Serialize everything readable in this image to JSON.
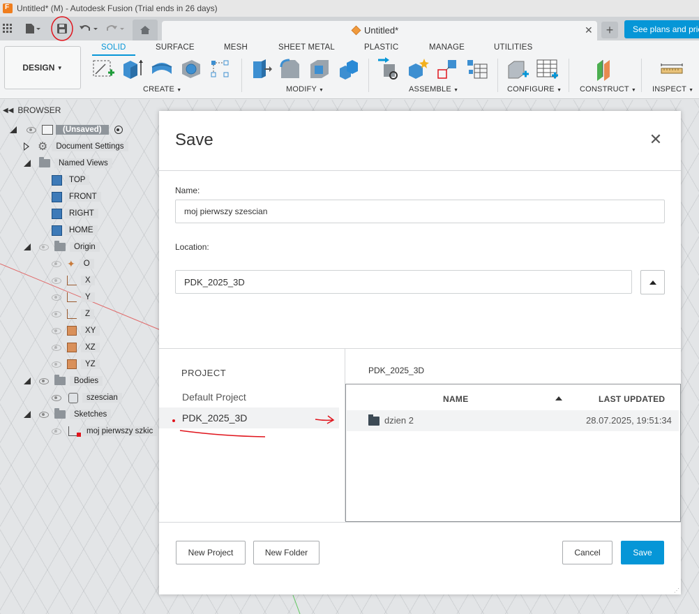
{
  "window": {
    "title": "Untitled* (M) - Autodesk Fusion (Trial ends in 26 days)"
  },
  "topbar": {
    "doc_tab_title": "Untitled*",
    "plans_button": "See plans and pricing",
    "icons": [
      "grid-icon",
      "file-icon",
      "save-icon",
      "undo-icon",
      "redo-icon",
      "home-icon",
      "cube-icon",
      "close-icon",
      "plus-icon"
    ]
  },
  "ribbon": {
    "workspace": "DESIGN",
    "tabs": [
      "SOLID",
      "SURFACE",
      "MESH",
      "SHEET METAL",
      "PLASTIC",
      "MANAGE",
      "UTILITIES"
    ],
    "active_tab": "SOLID",
    "groups": [
      "CREATE",
      "MODIFY",
      "ASSEMBLE",
      "CONFIGURE",
      "CONSTRUCT",
      "INSPECT"
    ]
  },
  "browser": {
    "title": "BROWSER",
    "root": "(Unsaved)",
    "items": [
      {
        "label": "Document Settings"
      },
      {
        "label": "Named Views"
      },
      {
        "label": "TOP"
      },
      {
        "label": "FRONT"
      },
      {
        "label": "RIGHT"
      },
      {
        "label": "HOME"
      },
      {
        "label": "Origin"
      },
      {
        "label": "O"
      },
      {
        "label": "X"
      },
      {
        "label": "Y"
      },
      {
        "label": "Z"
      },
      {
        "label": "XY"
      },
      {
        "label": "XZ"
      },
      {
        "label": "YZ"
      },
      {
        "label": "Bodies"
      },
      {
        "label": "szescian"
      },
      {
        "label": "Sketches"
      },
      {
        "label": "moj pierwszy szkic"
      }
    ]
  },
  "dialog": {
    "title": "Save",
    "name_label": "Name:",
    "name_value": "moj pierwszy szescian",
    "location_label": "Location:",
    "location_value": "PDK_2025_3D",
    "project_header": "PROJECT",
    "projects": [
      "Default Project",
      "PDK_2025_3D"
    ],
    "selected_project": "PDK_2025_3D",
    "breadcrumb": "PDK_2025_3D",
    "columns": {
      "name": "NAME",
      "last_updated": "LAST UPDATED"
    },
    "rows": [
      {
        "name": "dzien 2",
        "last_updated": "28.07.2025, 19:51:34"
      }
    ],
    "buttons": {
      "new_project": "New Project",
      "new_folder": "New Folder",
      "cancel": "Cancel",
      "save": "Save"
    }
  },
  "annotation_color": "#e0141c",
  "accent_color": "#0696d7"
}
